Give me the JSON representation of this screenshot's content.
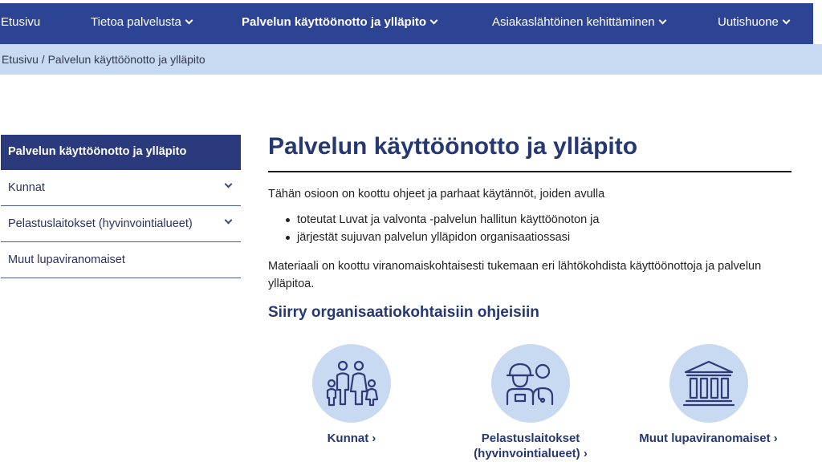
{
  "nav": {
    "items": [
      {
        "label": "Etusivu",
        "has_menu": false
      },
      {
        "label": "Tietoa palvelusta",
        "has_menu": true
      },
      {
        "label": "Palvelun käyttöönotto ja ylläpito",
        "has_menu": true,
        "active": true
      },
      {
        "label": "Asiakaslähtöinen kehittäminen",
        "has_menu": true
      },
      {
        "label": "Uutishuone",
        "has_menu": true
      }
    ]
  },
  "breadcrumb": {
    "text": "Etusivu / Palvelun käyttöönotto ja ylläpito"
  },
  "sidebar": {
    "active_label": "Palvelun käyttöönotto ja ylläpito",
    "items": [
      {
        "label": "Kunnat",
        "expandable": true
      },
      {
        "label": "Pelastuslaitokset (hyvinvointialueet)",
        "expandable": true
      },
      {
        "label": "Muut lupaviranomaiset",
        "expandable": false
      }
    ]
  },
  "main": {
    "title": "Palvelun käyttöönotto ja ylläpito",
    "intro": "Tähän osioon on koottu ohjeet ja parhaat käytännöt, joiden avulla",
    "bullets": [
      "toteutat Luvat ja valvonta -palvelun hallitun käyttöönoton ja",
      "järjestät sujuvan palvelun ylläpidon organisaatiossasi"
    ],
    "paragraph": "Materiaali on koottu viranomaiskohtaisesti tukemaan eri lähtökohdista käyttöönottoja ja palvelun ylläpitoa.",
    "section_heading": "Siirry organisaatiokohtaisiin ohjeisiin",
    "cards": [
      {
        "label_line1": "Kunnat ›",
        "label_line2": "",
        "icon": "family-icon"
      },
      {
        "label_line1": "Pelastuslaitokset",
        "label_line2": "(hyvinvointialueet) ›",
        "icon": "firefighter-paramedic-icon"
      },
      {
        "label_line1": "Muut lupaviranomaiset ›",
        "label_line2": "",
        "icon": "government-building-icon"
      }
    ]
  },
  "colors": {
    "nav_bg": "#2d4495",
    "breadcrumb_bg": "#c8d9f2",
    "heading": "#263873",
    "sidebar_active_bg": "#2b3a7c",
    "icon_circle": "#c8d9f2"
  }
}
